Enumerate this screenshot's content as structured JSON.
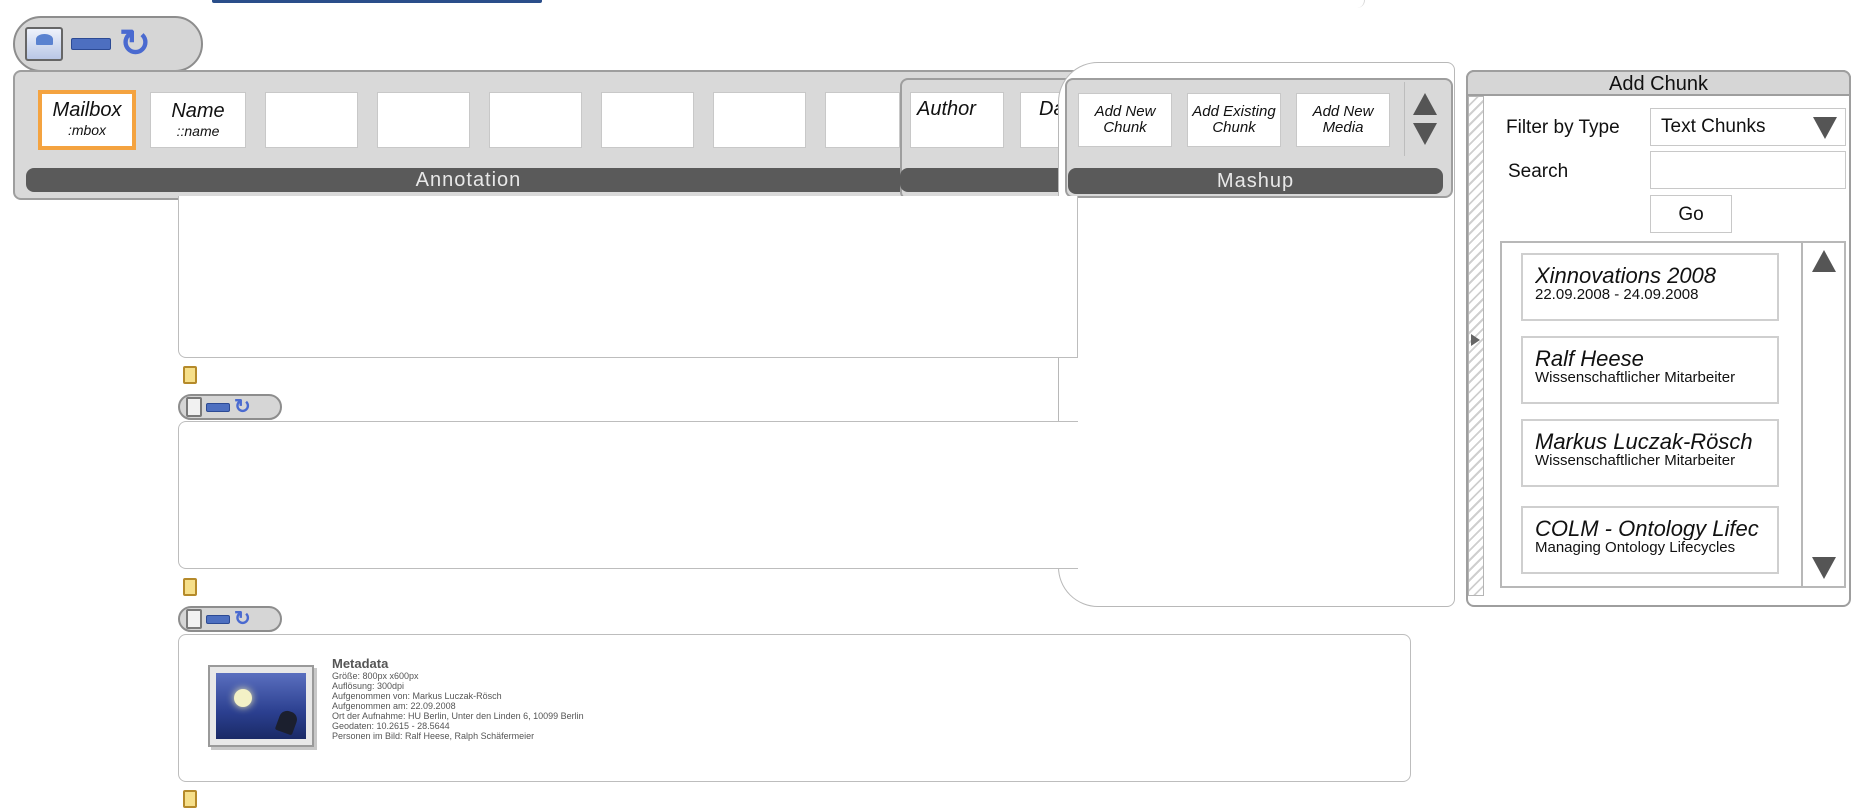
{
  "annotation": {
    "fields": [
      {
        "label": "Mailbox",
        "sub": ":mbox"
      },
      {
        "label": "Name",
        "sub": "::name"
      }
    ],
    "section_title": "Annotation"
  },
  "meta_fields": {
    "author_label": "Author",
    "second_label_partial": "Da"
  },
  "mashup": {
    "section_title": "Mashup",
    "buttons": [
      {
        "label": "Add New Chunk"
      },
      {
        "label": "Add Existing Chunk"
      },
      {
        "label": "Add New Media"
      }
    ]
  },
  "add_chunk": {
    "title": "Add Chunk",
    "filter_label": "Filter by Type",
    "filter_value": "Text Chunks",
    "search_label": "Search",
    "search_value": "",
    "go_label": "Go",
    "results": [
      {
        "title": "Xinnovations 2008",
        "subtitle": "22.09.2008 - 24.09.2008"
      },
      {
        "title": "Ralf Heese",
        "subtitle": "Wissenschaftlicher Mitarbeiter"
      },
      {
        "title": "Markus Luczak-Rösch",
        "subtitle": "Wissenschaftlicher Mitarbeiter"
      },
      {
        "title": "COLM - Ontology Lifec",
        "subtitle": "Managing Ontology Lifecycles"
      }
    ]
  },
  "metadata": {
    "title": "Metadata",
    "lines": [
      "Größe: 800px x600px",
      "Auflösung: 300dpi",
      "Aufgenommen von: Markus Luczak-Rösch",
      "Aufgenommen am: 22.09.2008",
      "Ort der Aufnahme: HU Berlin, Unter den Linden 6, 10099 Berlin",
      "Geodaten: 10.2615 - 28.5644",
      "Personen im Bild: Ralf Heese, Ralph Schäfermeier"
    ]
  },
  "icons": {
    "inbox": "inbox-icon",
    "collapse": "collapse-dash-icon",
    "refresh": "refresh-icon",
    "clipboard": "clipboard-icon",
    "note": "note-icon"
  },
  "colors": {
    "accent_orange": "#f4a340",
    "bar_dark": "#5a5a5a",
    "icon_blue": "#4d6fc0",
    "panel_gray": "#d9d9d9"
  }
}
